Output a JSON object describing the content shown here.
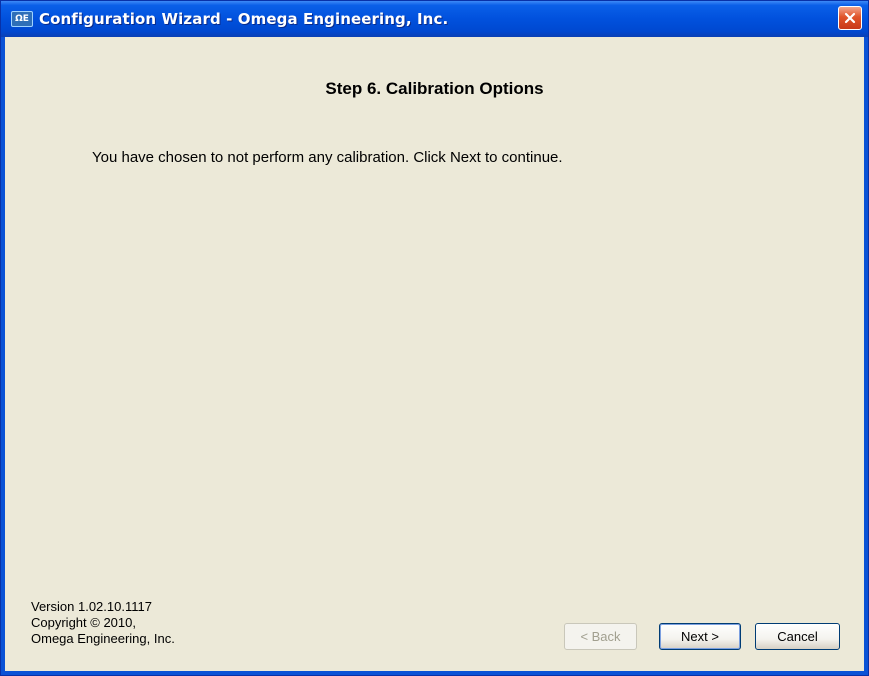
{
  "window": {
    "title": "Configuration Wizard - Omega Engineering, Inc.",
    "icon": "omega-app-icon"
  },
  "main": {
    "step_title": "Step 6.  Calibration Options",
    "message": "You have chosen to not perform any calibration.  Click Next to continue."
  },
  "footer": {
    "version": "Version 1.02.10.1117",
    "copyright": "Copyright © 2010,",
    "company": "Omega Engineering, Inc."
  },
  "buttons": {
    "back": "< Back",
    "next": "Next >",
    "cancel": "Cancel"
  },
  "colors": {
    "titlebar": "#0151dd",
    "client": "#ece9d8",
    "close": "#e0542a"
  }
}
